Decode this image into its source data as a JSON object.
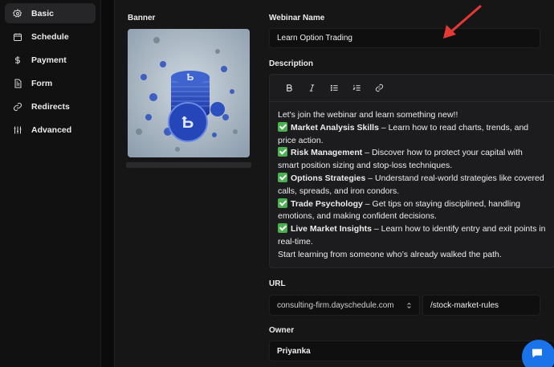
{
  "sidebar": {
    "items": [
      {
        "label": "Basic",
        "icon": "gear-icon",
        "active": true
      },
      {
        "label": "Schedule",
        "icon": "calendar-icon"
      },
      {
        "label": "Payment",
        "icon": "dollar-icon"
      },
      {
        "label": "Form",
        "icon": "form-icon"
      },
      {
        "label": "Redirects",
        "icon": "link-icon"
      },
      {
        "label": "Advanced",
        "icon": "sliders-icon"
      }
    ]
  },
  "banner": {
    "label": "Banner"
  },
  "webinar_name": {
    "label": "Webinar Name",
    "value": "Learn Option Trading"
  },
  "description": {
    "label": "Description",
    "toolbar": [
      "bold-icon",
      "italic-icon",
      "bullet-list-icon",
      "numbered-list-icon",
      "link-icon"
    ],
    "intro": "Let's join the webinar and learn something new!!",
    "points": [
      {
        "title": "Market Analysis Skills",
        "text": " – Learn how to read charts, trends, and price action."
      },
      {
        "title": "Risk Management",
        "text": " – Discover how to protect your capital with smart position sizing and stop-loss techniques."
      },
      {
        "title": "Options Strategies",
        "text": " – Understand real-world strategies like covered calls, spreads, and iron condors."
      },
      {
        "title": "Trade Psychology",
        "text": " – Get tips on staying disciplined, handling emotions, and making confident decisions."
      },
      {
        "title": "Live Market Insights",
        "text": " – Learn how to identify entry and exit points in real-time."
      }
    ],
    "outro": "Start learning from someone who’s already walked the path."
  },
  "url": {
    "label": "URL",
    "domain": "consulting-firm.dayschedule.com",
    "slug": "/stock-market-rules"
  },
  "owner": {
    "label": "Owner",
    "value": "Priyanka"
  },
  "colors": {
    "accent": "#1a73e8",
    "arrow": "#e53935",
    "check": "#4caf50"
  }
}
